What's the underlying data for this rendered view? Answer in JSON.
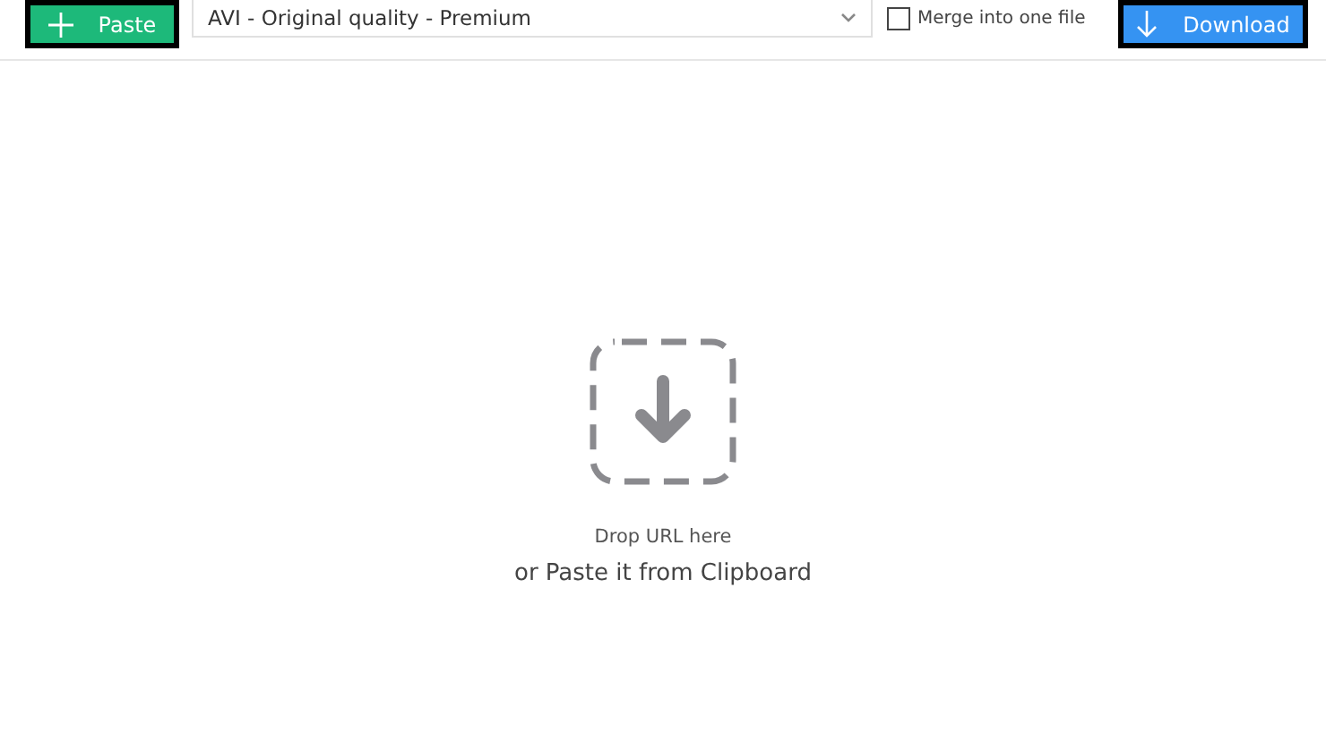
{
  "toolbar": {
    "paste_button": {
      "label": "Paste"
    },
    "format_select": {
      "value": "AVI - Original quality - Premium"
    },
    "merge": {
      "label": "Merge into one file",
      "checked": false
    },
    "download_button": {
      "label": "Download"
    }
  },
  "drop_zone": {
    "hint": "Drop URL here",
    "subhint": "or Paste it from Clipboard"
  }
}
